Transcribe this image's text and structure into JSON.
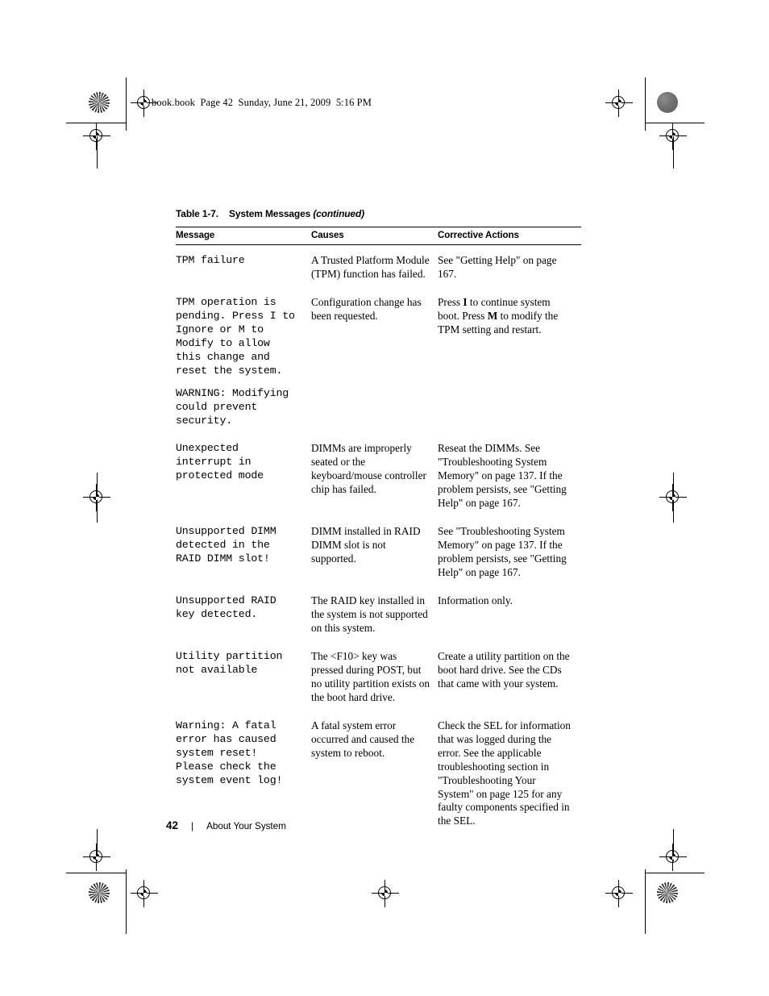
{
  "page": {
    "running_head": "book.book  Page 42  Sunday, June 21, 2009  5:16 PM",
    "folio_number": "42",
    "folio_separator": "|",
    "folio_section": "About Your System"
  },
  "table": {
    "caption_number": "Table 1-7.",
    "caption_title": "System Messages",
    "caption_continued": "(continued)",
    "columns": [
      "Message",
      "Causes",
      "Corrective Actions"
    ],
    "rows": [
      {
        "message": [
          "TPM failure"
        ],
        "cause": "A Trusted Platform Module (TPM) function has failed.",
        "action_parts": [
          {
            "text": "See \"Getting Help\" on page 167.",
            "bold": false
          }
        ]
      },
      {
        "message": [
          "TPM operation is\npending. Press I to\nIgnore or M to\nModify to allow\nthis change and\nreset the system.",
          "WARNING: Modifying\ncould prevent\nsecurity."
        ],
        "cause": "Configuration change has been requested.",
        "action_parts": [
          {
            "text": "Press ",
            "bold": false
          },
          {
            "text": "I",
            "bold": true
          },
          {
            "text": " to continue system boot. Press ",
            "bold": false
          },
          {
            "text": "M",
            "bold": true
          },
          {
            "text": " to modify the TPM setting and restart.",
            "bold": false
          }
        ]
      },
      {
        "message": [
          "Unexpected\ninterrupt in\nprotected mode"
        ],
        "cause": "DIMMs are improperly seated or the keyboard/mouse controller chip has failed.",
        "action_parts": [
          {
            "text": "Reseat the DIMMs. See \"Troubleshooting System Memory\" on page 137. If the problem persists, see \"Getting Help\" on page 167.",
            "bold": false
          }
        ]
      },
      {
        "message": [
          "Unsupported DIMM\ndetected in the\nRAID DIMM slot!"
        ],
        "cause": "DIMM installed in RAID DIMM slot is not supported.",
        "action_parts": [
          {
            "text": "See \"Troubleshooting System Memory\" on page 137. If the problem persists, see \"Getting Help\" on page 167.",
            "bold": false
          }
        ]
      },
      {
        "message": [
          "Unsupported RAID\nkey detected."
        ],
        "cause": "The RAID key installed in the system is not supported on this system.",
        "action_parts": [
          {
            "text": "Information only.",
            "bold": false
          }
        ]
      },
      {
        "message": [
          "Utility partition\nnot available"
        ],
        "cause": "The <F10> key was pressed during POST, but no utility partition exists on the boot hard drive.",
        "action_parts": [
          {
            "text": "Create a utility partition on the boot hard drive. See the CDs that came with your system.",
            "bold": false
          }
        ]
      },
      {
        "message": [
          "Warning: A fatal\nerror has caused\nsystem reset!\nPlease check the\nsystem event log!"
        ],
        "cause": "A fatal system error occurred and caused the system to reboot.",
        "action_parts": [
          {
            "text": "Check the SEL for information that was logged during the error. See the applicable troubleshooting section in \"Troubleshooting Your System\" on page 125 for any faulty components specified in the SEL.",
            "bold": false
          }
        ]
      }
    ]
  },
  "printer_marks": {
    "registration_icon": "registration-target-icon",
    "halftone_star_icon": "halftone-star-target-icon",
    "halftone_solid_icon": "halftone-density-patch-icon"
  }
}
